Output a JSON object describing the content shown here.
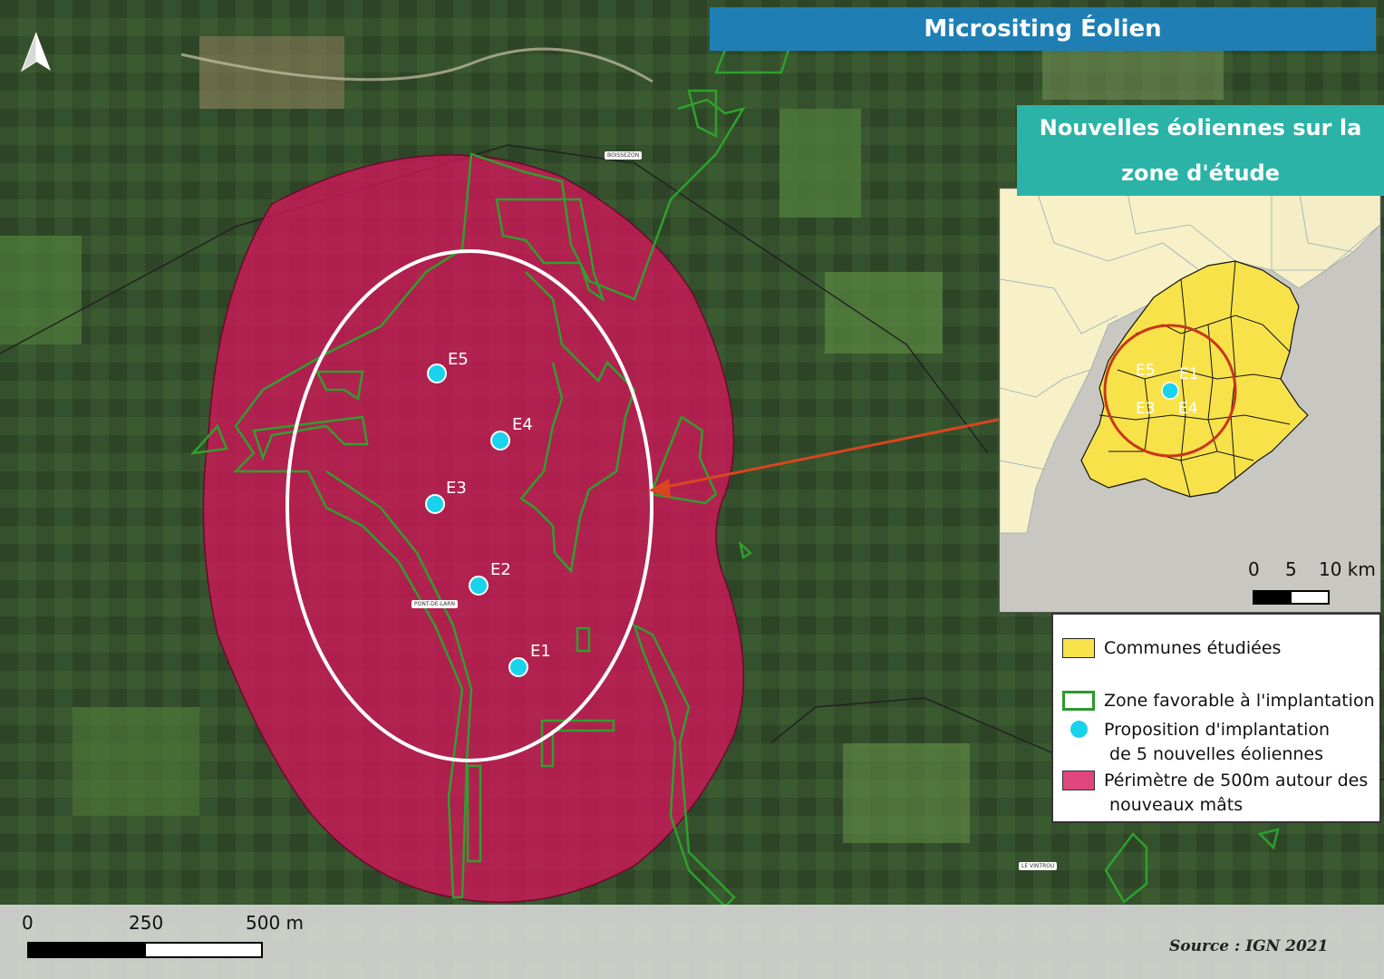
{
  "title": "Micrositing Éolien",
  "inset": {
    "title_line1": "Nouvelles éoliennes sur la",
    "title_line2": "zone d'étude",
    "scale": {
      "labels": [
        "0",
        "5",
        "10 km"
      ]
    },
    "turbine_labels": [
      "E1",
      "E3",
      "E4",
      "E5"
    ]
  },
  "legend": {
    "items": [
      {
        "label": "Communes étudiées",
        "color": "#f7e24a"
      },
      {
        "label": "Zone favorable à l'implantation",
        "color": "#2a9a2a"
      },
      {
        "label": "Proposition d'implantation\n de 5 nouvelles éoliennes",
        "color": "#19d3ec"
      },
      {
        "label": "Périmètre de 500m autour des\n nouveaux mâts",
        "color": "#e0457e"
      }
    ]
  },
  "scale": {
    "labels": [
      "0",
      "250",
      "500 m"
    ]
  },
  "source": "Source : IGN 2021",
  "turbines": [
    {
      "id": "E1",
      "label": "E1"
    },
    {
      "id": "E2",
      "label": "E2"
    },
    {
      "id": "E3",
      "label": "E3"
    },
    {
      "id": "E4",
      "label": "E4"
    },
    {
      "id": "E5",
      "label": "E5"
    }
  ],
  "place_labels": [
    "BOISSEZON",
    "PONT-DE-LARN",
    "LE VINTROU"
  ],
  "colors": {
    "turbine": "#19d3ec",
    "perimeter": "#d4145a",
    "zone": "#2ea02e",
    "arrow": "#d9451f"
  }
}
